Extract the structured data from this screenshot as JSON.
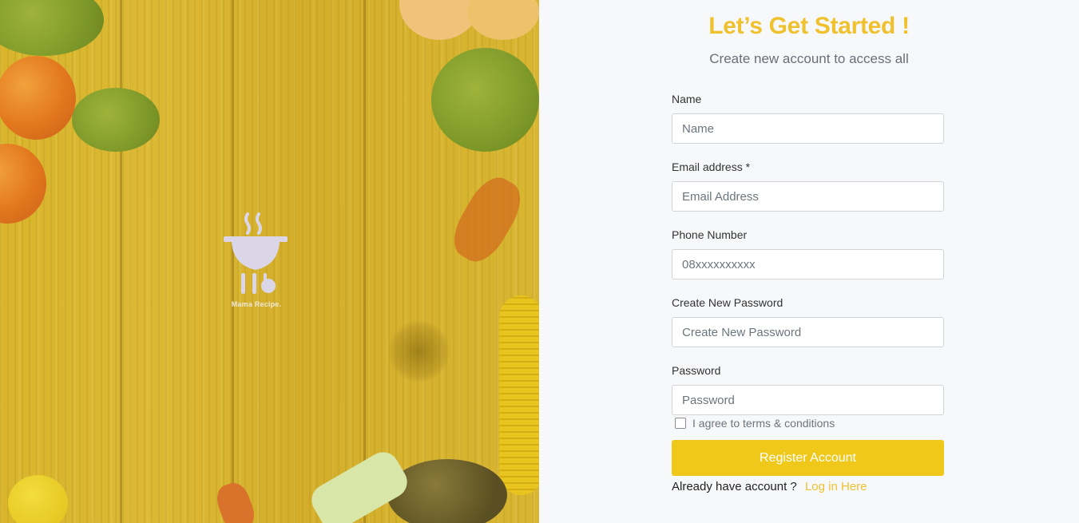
{
  "hero": {
    "logo_text": "Mama Recipe.",
    "overlay_color": "#d9b52c"
  },
  "form": {
    "title": "Let’s Get Started !",
    "subtitle": "Create new account to access all",
    "fields": [
      {
        "label": "Name",
        "placeholder": "Name"
      },
      {
        "label": "Email address *",
        "placeholder": "Email Address"
      },
      {
        "label": "Phone Number",
        "placeholder": "08xxxxxxxxxx"
      },
      {
        "label": "Create New Password",
        "placeholder": "Create New Password"
      },
      {
        "label": "Password",
        "placeholder": "Password"
      }
    ],
    "terms_label": "I agree to terms & conditions",
    "register_label": "Register Account",
    "login_prompt": "Already have account ?",
    "login_link": "Log in Here",
    "accent_color": "#efc12f"
  }
}
